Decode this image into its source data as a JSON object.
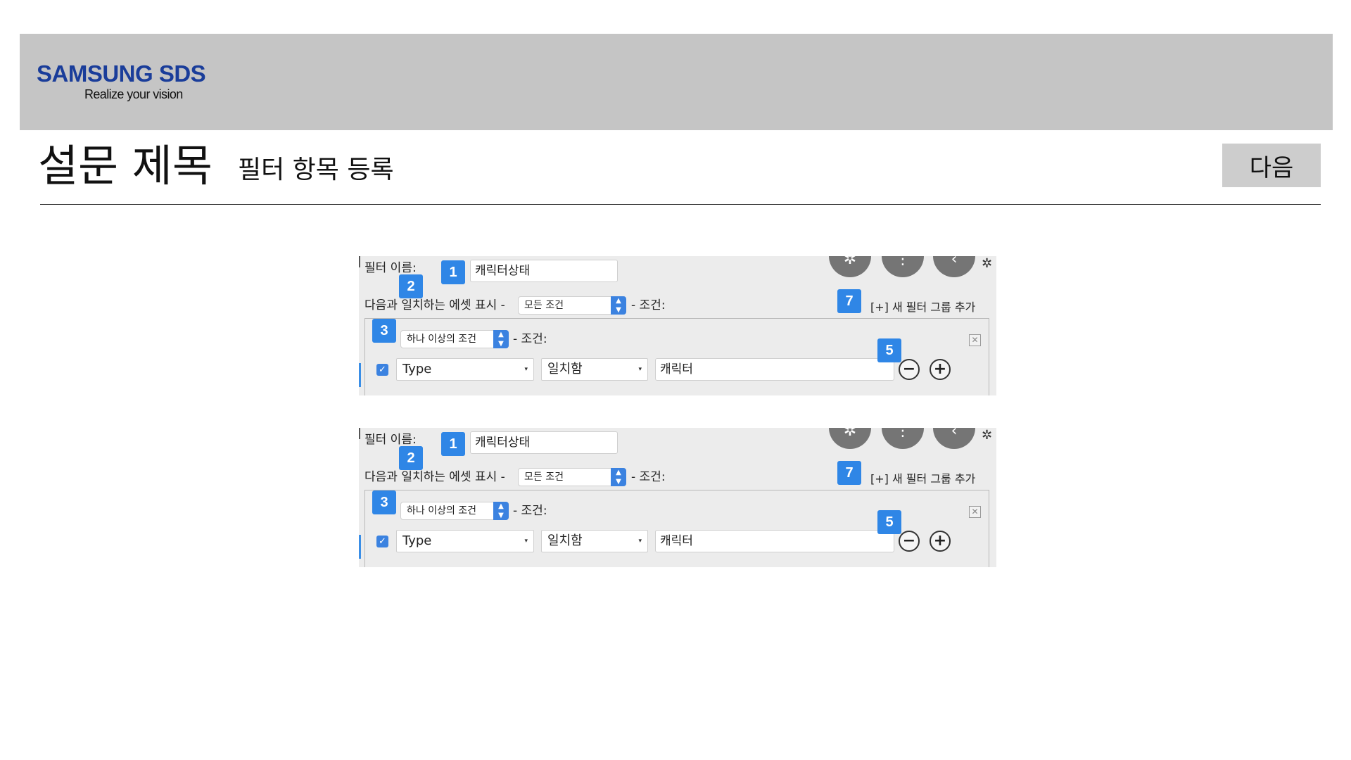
{
  "header": {
    "brand": "SAMSUNG SDS",
    "tagline": "Realize your vision"
  },
  "page": {
    "title": "설문 제목",
    "subtitle": "필터 항목 등록",
    "next_label": "다음"
  },
  "filter_panel": {
    "name_label": "필터 이름:",
    "name_value": "캐릭터상태",
    "match_label": "다음과 일치하는 에셋 표시 -",
    "match_option": "모든 조건",
    "conditions_suffix": "- 조건:",
    "add_group_label": "[+] 새 필터 그룹 추가",
    "group_match_option": "하나 이상의 조건",
    "row": {
      "checked": true,
      "field": "Type",
      "operator": "일치함",
      "value": "캐릭터"
    },
    "badges": [
      "1",
      "2",
      "3",
      "5",
      "7"
    ]
  },
  "icons": {
    "checkbox": "checkmark-icon",
    "minus": "minus-circle-icon",
    "plus": "plus-circle-icon",
    "close": "close-box-icon",
    "stepper": "up-down-icon",
    "caret": "dropdown-caret-icon",
    "toolbar": [
      "target-icon",
      "more-vertical-icon",
      "back-chevron-icon",
      "gear-icon"
    ]
  },
  "colors": {
    "brand_blue": "#1a3d9a",
    "accent_blue": "#2f86e6",
    "header_gray": "#c5c5c5"
  }
}
